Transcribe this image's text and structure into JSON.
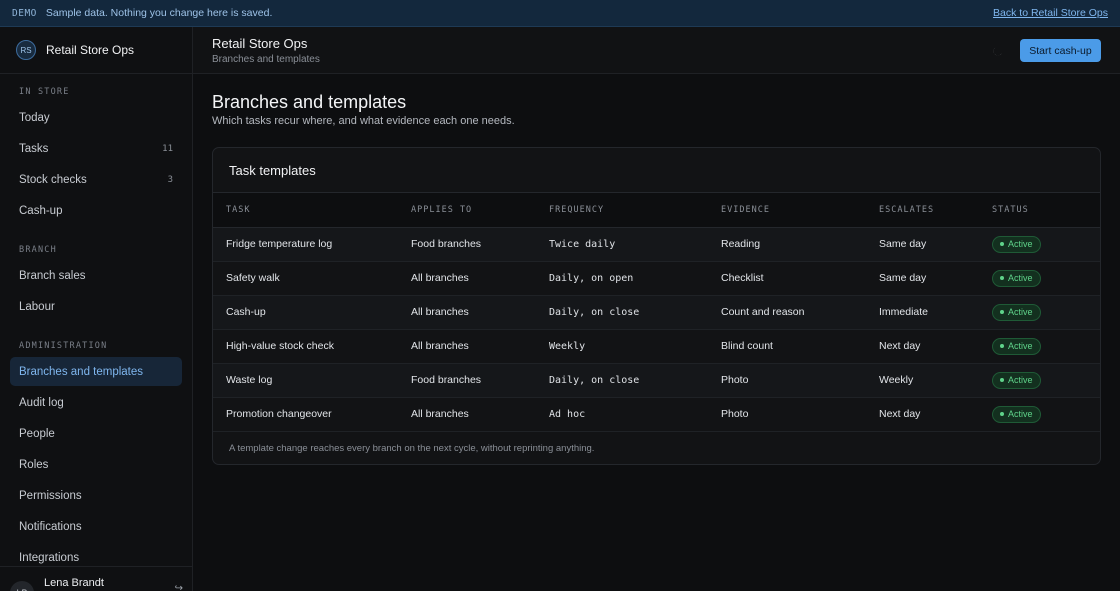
{
  "banner": {
    "tag": "DEMO",
    "message": "Sample data. Nothing you change here is saved.",
    "back_link": "Back to Retail Store Ops"
  },
  "sidebar": {
    "brand_initials": "RS",
    "brand_name": "Retail Store Ops",
    "sections": [
      {
        "label": "IN STORE",
        "items": [
          {
            "label": "Today",
            "count": ""
          },
          {
            "label": "Tasks",
            "count": "11"
          },
          {
            "label": "Stock checks",
            "count": "3"
          },
          {
            "label": "Cash-up",
            "count": ""
          }
        ]
      },
      {
        "label": "BRANCH",
        "items": [
          {
            "label": "Branch sales",
            "count": ""
          },
          {
            "label": "Labour",
            "count": ""
          }
        ]
      },
      {
        "label": "ADMINISTRATION",
        "items": [
          {
            "label": "Branches and templates",
            "count": "",
            "active": true
          },
          {
            "label": "Audit log",
            "count": ""
          },
          {
            "label": "People",
            "count": ""
          },
          {
            "label": "Roles",
            "count": ""
          },
          {
            "label": "Permissions",
            "count": ""
          },
          {
            "label": "Notifications",
            "count": ""
          },
          {
            "label": "Integrations",
            "count": ""
          }
        ]
      }
    ],
    "user": {
      "initials": "LB",
      "name": "Lena Brandt",
      "action_icon": "logout-icon"
    }
  },
  "topbar": {
    "title": "Retail Store Ops",
    "subtitle": "Branches and templates",
    "theme_icon": "moon-icon",
    "primary_button": "Start cash-up"
  },
  "main": {
    "title": "Branches and templates",
    "subtitle": "Which tasks recur where, and what evidence each one needs.",
    "card": {
      "title": "Task templates",
      "columns": [
        "TASK",
        "APPLIES TO",
        "FREQUENCY",
        "EVIDENCE",
        "ESCALATES",
        "STATUS"
      ],
      "rows": [
        {
          "task": "Fridge temperature log",
          "applies_to": "Food branches",
          "frequency": "Twice daily",
          "evidence": "Reading",
          "escalates": "Same day",
          "status": "Active"
        },
        {
          "task": "Safety walk",
          "applies_to": "All branches",
          "frequency": "Daily, on open",
          "evidence": "Checklist",
          "escalates": "Same day",
          "status": "Active"
        },
        {
          "task": "Cash-up",
          "applies_to": "All branches",
          "frequency": "Daily, on close",
          "evidence": "Count and reason",
          "escalates": "Immediate",
          "status": "Active"
        },
        {
          "task": "High-value stock check",
          "applies_to": "All branches",
          "frequency": "Weekly",
          "evidence": "Blind count",
          "escalates": "Next day",
          "status": "Active"
        },
        {
          "task": "Waste log",
          "applies_to": "Food branches",
          "frequency": "Daily, on close",
          "evidence": "Photo",
          "escalates": "Weekly",
          "status": "Active"
        },
        {
          "task": "Promotion changeover",
          "applies_to": "All branches",
          "frequency": "Ad hoc",
          "evidence": "Photo",
          "escalates": "Next day",
          "status": "Active"
        }
      ],
      "footer": "A template change reaches every branch on the next cycle, without reprinting anything."
    }
  },
  "colors": {
    "accent": "#4b9be8",
    "active_nav_bg": "#172638",
    "status_active": "#5fd38a",
    "banner_bg": "#13283d"
  }
}
